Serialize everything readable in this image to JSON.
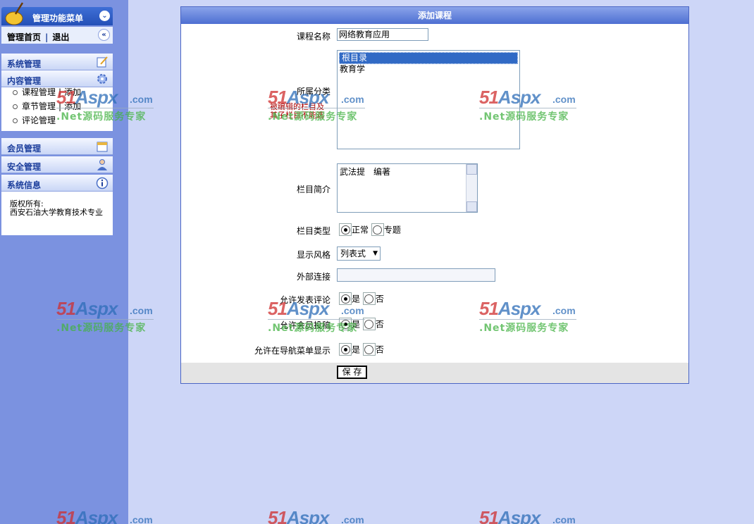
{
  "sidebar": {
    "title": "管理功能菜单",
    "home": "管理首页",
    "home_sep": "|",
    "logout": "退出",
    "sections": [
      {
        "label": "系统管理"
      },
      {
        "label": "内容管理"
      },
      {
        "label": "会员管理"
      },
      {
        "label": "安全管理"
      },
      {
        "label": "系统信息"
      }
    ],
    "content_items": [
      {
        "label": "课程管理",
        "sep": "|",
        "action": "添加"
      },
      {
        "label": "章节管理",
        "sep": "|",
        "action": "添加"
      },
      {
        "label": "评论管理"
      }
    ],
    "copyright_label": "版权所有:",
    "copyright_owner": "西安石油大学教育技术专业"
  },
  "form": {
    "title": "添加课程",
    "name_label": "课程名称",
    "name_value": "网络教育应用",
    "category_label": "所属分类",
    "category_note_1": "被编辑的栏目及",
    "category_note_2": "其子栏目不能选",
    "category_options": [
      "根目录",
      "教育学"
    ],
    "category_selected": "根目录",
    "intro_label": "栏目简介",
    "intro_value": "武法提　编著",
    "type_label": "栏目类型",
    "type_options": [
      "正常",
      "专题"
    ],
    "type_selected": "正常",
    "style_label": "显示风格",
    "style_value": "列表式",
    "link_label": "外部连接",
    "link_value": "",
    "comment_label": "允许发表评论",
    "comment_yes": "是",
    "comment_no": "否",
    "submit_label": "允许会员投稿",
    "submit_yes": "是",
    "submit_no": "否",
    "nav_label": "允许在导航菜单显示",
    "nav_yes": "是",
    "nav_no": "否",
    "save_label": "保 存"
  },
  "watermark": {
    "brand": "51Aspx",
    "domain": ".com",
    "tagline": ".Net源码服务专家"
  }
}
